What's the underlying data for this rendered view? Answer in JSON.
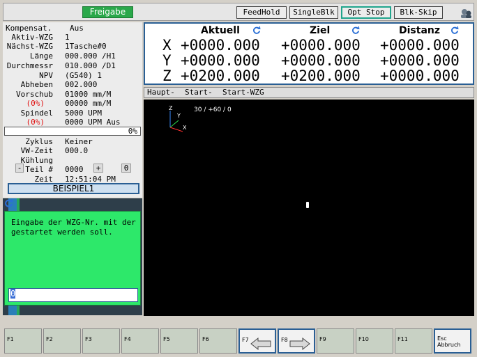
{
  "topbar": {
    "freigabe": "Freigabe",
    "feedhold": "FeedHold",
    "singleblk": "SingleBlk",
    "optstop": "Opt Stop",
    "blkskip": "Blk-Skip"
  },
  "info": {
    "kompensat_label": "Kompensat.",
    "kompensat_value": "Aus",
    "aktiv_wzg_label": "Aktiv-WZG",
    "aktiv_wzg_value": "1",
    "naechst_wzg_label": "Nächst-WZG",
    "naechst_wzg_value": "1Tasche#0",
    "laenge_label": "Länge",
    "laenge_value": "000.000 /H1",
    "durchmesser_label": "Durchmessr",
    "durchmesser_value": "010.000 /D1",
    "npv_label": "NPV",
    "npv_value": "(G540) 1",
    "abheben_label": "Abheben",
    "abheben_value": "002.000",
    "vorschub_label": "Vorschub",
    "vorschub_value": "01000 mm/M",
    "vorschub_pct": "(0%)",
    "vorschub_pct_value": "00000 mm/M",
    "spindel_label": "Spindel",
    "spindel_value": "5000 UPM",
    "spindel_pct": "(0%)",
    "spindel_pct_value": "0000 UPM Aus",
    "progress_text": "0%",
    "zyklus_label": "Zyklus",
    "zyklus_value": "Keiner",
    "vwzeit_label": "VW-Zeit",
    "vwzeit_value": "000.0",
    "kuehlung_label": "Kühlung",
    "teil_minus": "-",
    "teil_label": "Teil #",
    "teil_value": "0000",
    "teil_plus": "+",
    "teil_count": "0",
    "zeit_label": "Zeit",
    "zeit_value": "12:51:04 PM",
    "program_name": "BEISPIEL1"
  },
  "progress": {
    "fraction": 0
  },
  "dialog": {
    "text": "Eingabe der WZG-Nr. mit der gestartet werden soll.",
    "input_value": "0"
  },
  "dro": {
    "head_aktuell": "Aktuell",
    "head_ziel": "Ziel",
    "head_distanz": "Distanz",
    "rows": [
      {
        "axis": "X",
        "aktuell": "+0000.000",
        "ziel": "+0000.000",
        "distanz": "+0000.000"
      },
      {
        "axis": "Y",
        "aktuell": "+0000.000",
        "ziel": "+0000.000",
        "distanz": "+0000.000"
      },
      {
        "axis": "Z",
        "aktuell": "+0200.000",
        "ziel": "+0200.000",
        "distanz": "+0000.000"
      }
    ]
  },
  "tabs": {
    "haupt": "Haupt-",
    "start": "Start-",
    "start_wzg": "Start-WZG"
  },
  "graphics": {
    "axis_z": "Z",
    "axis_y": "Y",
    "axis_x": "X",
    "view_angles": "30 / +60 / 0"
  },
  "fkeys": {
    "f1": "F1",
    "f2": "F2",
    "f3": "F3",
    "f4": "F4",
    "f5": "F5",
    "f6": "F6",
    "f7": "F7",
    "f8": "F8",
    "f9": "F9",
    "f10": "F10",
    "f11": "F11",
    "esc_line1": "Esc",
    "esc_line2": "Abbruch"
  },
  "colors": {
    "accent": "#2a5f94",
    "go_green": "#2aa84a",
    "dialog_green": "#2de86a",
    "alert_red": "#e01010"
  }
}
